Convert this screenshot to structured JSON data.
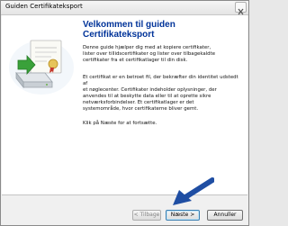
{
  "window": {
    "title": "Guiden Certifikateksport"
  },
  "content": {
    "heading": "Velkommen til guiden\nCertifikateksport",
    "paragraph1": "Denne guide hjælper dig med at kopiere certifikater,\nlister over tillidscertifikater og lister over tilbagekaldte\ncertifikater fra et certifikatlager til din disk.",
    "paragraph2": "Et certifikat er en betroet fil, der bekræfter din identitet udstedt af\net nøglecenter. Certifikater indeholder oplysninger, der\nanvendes til at beskytte data eller til at oprette sikre\nnetværksforbindelser. Et certifikatlager er det\nsystemområde, hvor certifikaterne bliver gemt.",
    "paragraph3": "Klik på Næste for at fortsætte."
  },
  "buttons": {
    "back": "< Tilbage",
    "next": "Næste >",
    "cancel": "Annuller"
  },
  "icons": {
    "illustration": "certificate-export-illustration",
    "pointer": "blue-arrow-icon",
    "close": "close-icon"
  },
  "colors": {
    "heading": "#003399",
    "arrow": "#1f4ea3",
    "window_bg": "#f0f0f0"
  }
}
